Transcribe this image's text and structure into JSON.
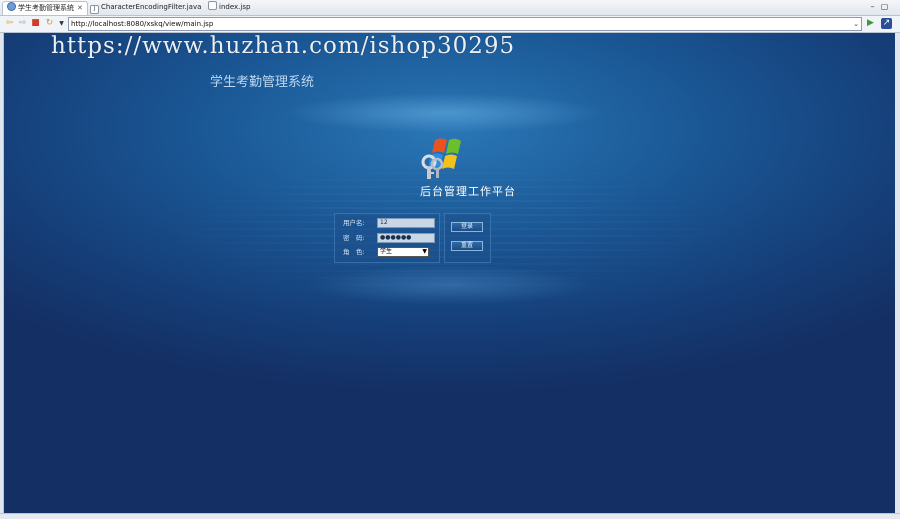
{
  "browser": {
    "tabs": [
      {
        "label": "学生考勤管理系统",
        "icon": "globe-icon",
        "active": true,
        "close": "✕"
      },
      {
        "label": "CharacterEncodingFilter.java",
        "icon": "java-file-icon",
        "active": false
      },
      {
        "label": "index.jsp",
        "icon": "jsp-file-icon",
        "active": false
      }
    ],
    "url": "http://localhost:8080/xskq/view/main.jsp"
  },
  "page": {
    "watermark": "https://www.huzhan.com/ishop30295",
    "system_title": "学生考勤管理系统",
    "platform_title": "后台管理工作平台",
    "form": {
      "username_label": "用户名:",
      "username_value": "12",
      "password_label": "密　码:",
      "password_value": "●●●●●●",
      "role_label": "角　色:",
      "role_value": "学生",
      "login_button": "登录",
      "reset_button": "重置"
    }
  },
  "colors": {
    "background_top": "#2a77b6",
    "background_bottom": "#142f64",
    "title_text": "#bcd7f0"
  }
}
